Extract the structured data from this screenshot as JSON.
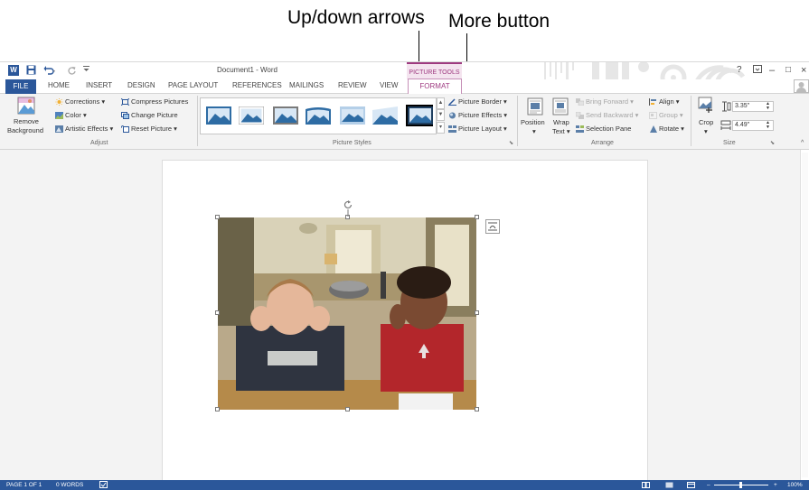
{
  "callouts": {
    "up_down_arrows": "Up/down arrows",
    "more_button": "More button"
  },
  "titlebar": {
    "app_icon_label": "W",
    "document_title": "Document1 - Word",
    "context_tab_group": "PICTURE TOOLS",
    "help": "?",
    "minimize": "–",
    "restore": "□",
    "close": "×"
  },
  "tabs": [
    "FILE",
    "HOME",
    "INSERT",
    "DESIGN",
    "PAGE LAYOUT",
    "REFERENCES",
    "MAILINGS",
    "REVIEW",
    "VIEW",
    "FORMAT"
  ],
  "ribbon": {
    "adjust": {
      "remove_background_line1": "Remove",
      "remove_background_line2": "Background",
      "corrections": "Corrections ▾",
      "color": "Color ▾",
      "artistic_effects": "Artistic Effects ▾",
      "compress_pictures": "Compress Pictures",
      "change_picture": "Change Picture",
      "reset_picture": "Reset Picture  ▾",
      "group_label": "Adjust"
    },
    "picture_styles": {
      "picture_border": "Picture Border ▾",
      "picture_effects": "Picture Effects ▾",
      "picture_layout": "Picture Layout ▾",
      "group_label": "Picture Styles",
      "scroll_up": "▲",
      "scroll_down": "▼",
      "more": "▾"
    },
    "arrange": {
      "position_line1": "Position",
      "position_line2": "▾",
      "wrap_text_line1": "Wrap",
      "wrap_text_line2": "Text ▾",
      "bring_forward": "Bring Forward  ▾",
      "send_backward": "Send Backward  ▾",
      "selection_pane": "Selection Pane",
      "align": "Align ▾",
      "group": "Group ▾",
      "rotate": "Rotate ▾",
      "group_label": "Arrange"
    },
    "size": {
      "crop_line1": "Crop",
      "crop_line2": "▾",
      "height": "3.35\"",
      "width": "4.49\"",
      "group_label": "Size"
    }
  },
  "statusbar": {
    "page": "PAGE 1 OF 1",
    "words": "0 WORDS",
    "zoom_minus": "–",
    "zoom_plus": "+",
    "zoom_level": "100%"
  },
  "colors": {
    "word_blue": "#2b579a",
    "picture_tools_accent": "#9e3a80",
    "ribbon_bg": "#f3f3f3"
  }
}
